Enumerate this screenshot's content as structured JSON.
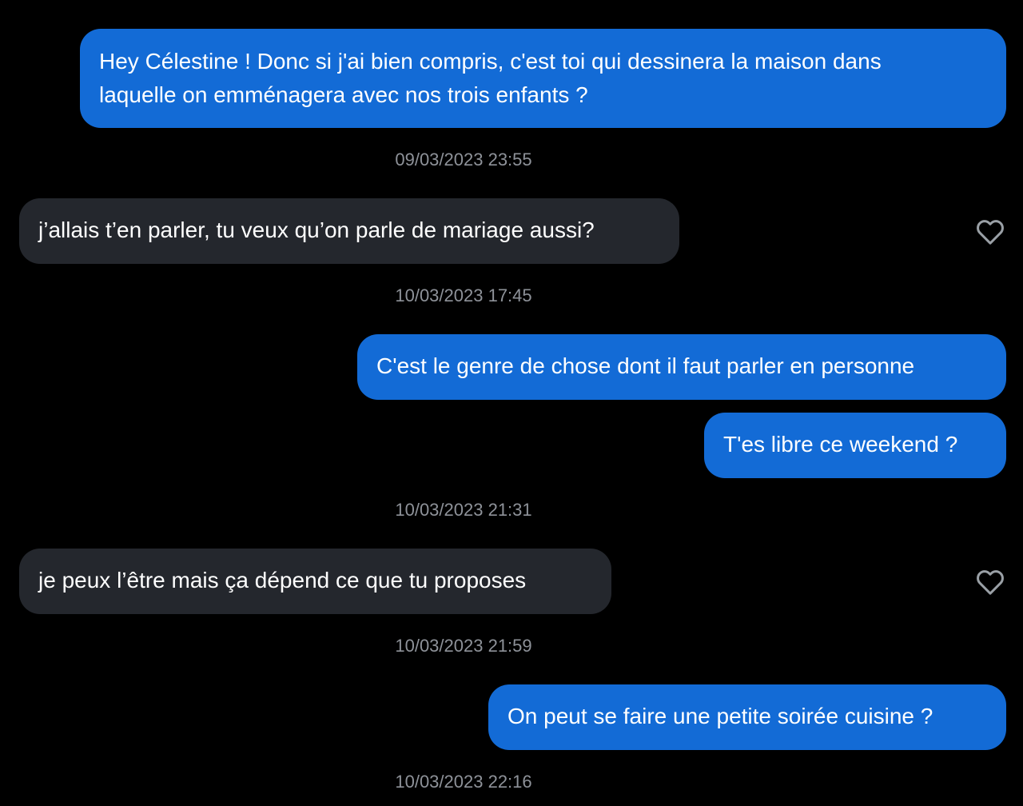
{
  "colors": {
    "background": "#000000",
    "sent_bubble": "#136bd6",
    "received_bubble": "#24272d",
    "timestamp_text": "#8e9299",
    "heart_outline": "#9aa0a6"
  },
  "messages": [
    {
      "kind": "sent",
      "line1": "Hey Célestine ! Donc si j'ai bien compris, c'est toi qui dessinera la maison dans",
      "line2": "laquelle on emménagera avec nos trois enfants ?"
    },
    {
      "kind": "timestamp",
      "text": "09/03/2023 23:55"
    },
    {
      "kind": "received",
      "text": "j’allais t’en parler, tu veux qu’on parle de mariage aussi?",
      "icon": "heart-outline-icon"
    },
    {
      "kind": "timestamp",
      "text": "10/03/2023 17:45"
    },
    {
      "kind": "sent",
      "text": "C'est le genre de chose dont il faut parler en personne"
    },
    {
      "kind": "sent",
      "text": "T'es libre ce weekend ?"
    },
    {
      "kind": "timestamp",
      "text": "10/03/2023 21:31"
    },
    {
      "kind": "received",
      "text": "je peux l’être mais ça dépend ce que tu proposes",
      "icon": "heart-outline-icon"
    },
    {
      "kind": "timestamp",
      "text": "10/03/2023 21:59"
    },
    {
      "kind": "sent",
      "text": "On peut se faire une petite soirée cuisine ?"
    },
    {
      "kind": "timestamp",
      "text": "10/03/2023 22:16"
    }
  ]
}
